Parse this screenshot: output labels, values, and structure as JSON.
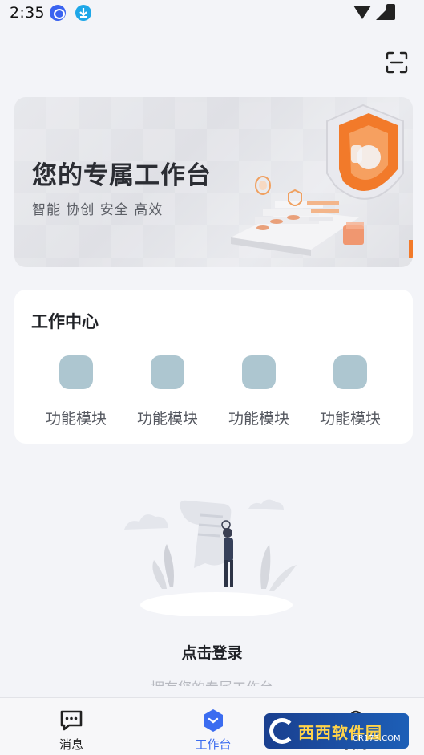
{
  "status_bar": {
    "time": "2:35",
    "icons": [
      "chat-notification-icon",
      "download-notification-icon",
      "wifi-icon",
      "signal-icon",
      "battery-icon"
    ]
  },
  "header": {
    "scan_icon": "scan-icon"
  },
  "banner": {
    "title": "您的专属工作台",
    "subtitle": "智能 协创 安全 高效"
  },
  "work_center": {
    "title": "工作中心",
    "modules": [
      {
        "label": "功能模块"
      },
      {
        "label": "功能模块"
      },
      {
        "label": "功能模块"
      },
      {
        "label": "功能模块"
      }
    ]
  },
  "empty_state": {
    "login_label": "点击登录",
    "description": "拥有您的专属工作台"
  },
  "bottom_nav": {
    "items": [
      {
        "label": "消息",
        "icon": "message-icon",
        "active": false
      },
      {
        "label": "工作台",
        "icon": "workbench-icon",
        "active": true
      },
      {
        "label": "我的",
        "icon": "profile-icon",
        "active": false
      }
    ]
  },
  "watermark": {
    "text": "西西软件园",
    "sub": "CR173.COM"
  },
  "colors": {
    "accent": "#3b6cf0",
    "module_icon": "#adc6d0",
    "background": "#f3f4f8",
    "shield_orange": "#f27a2a"
  }
}
